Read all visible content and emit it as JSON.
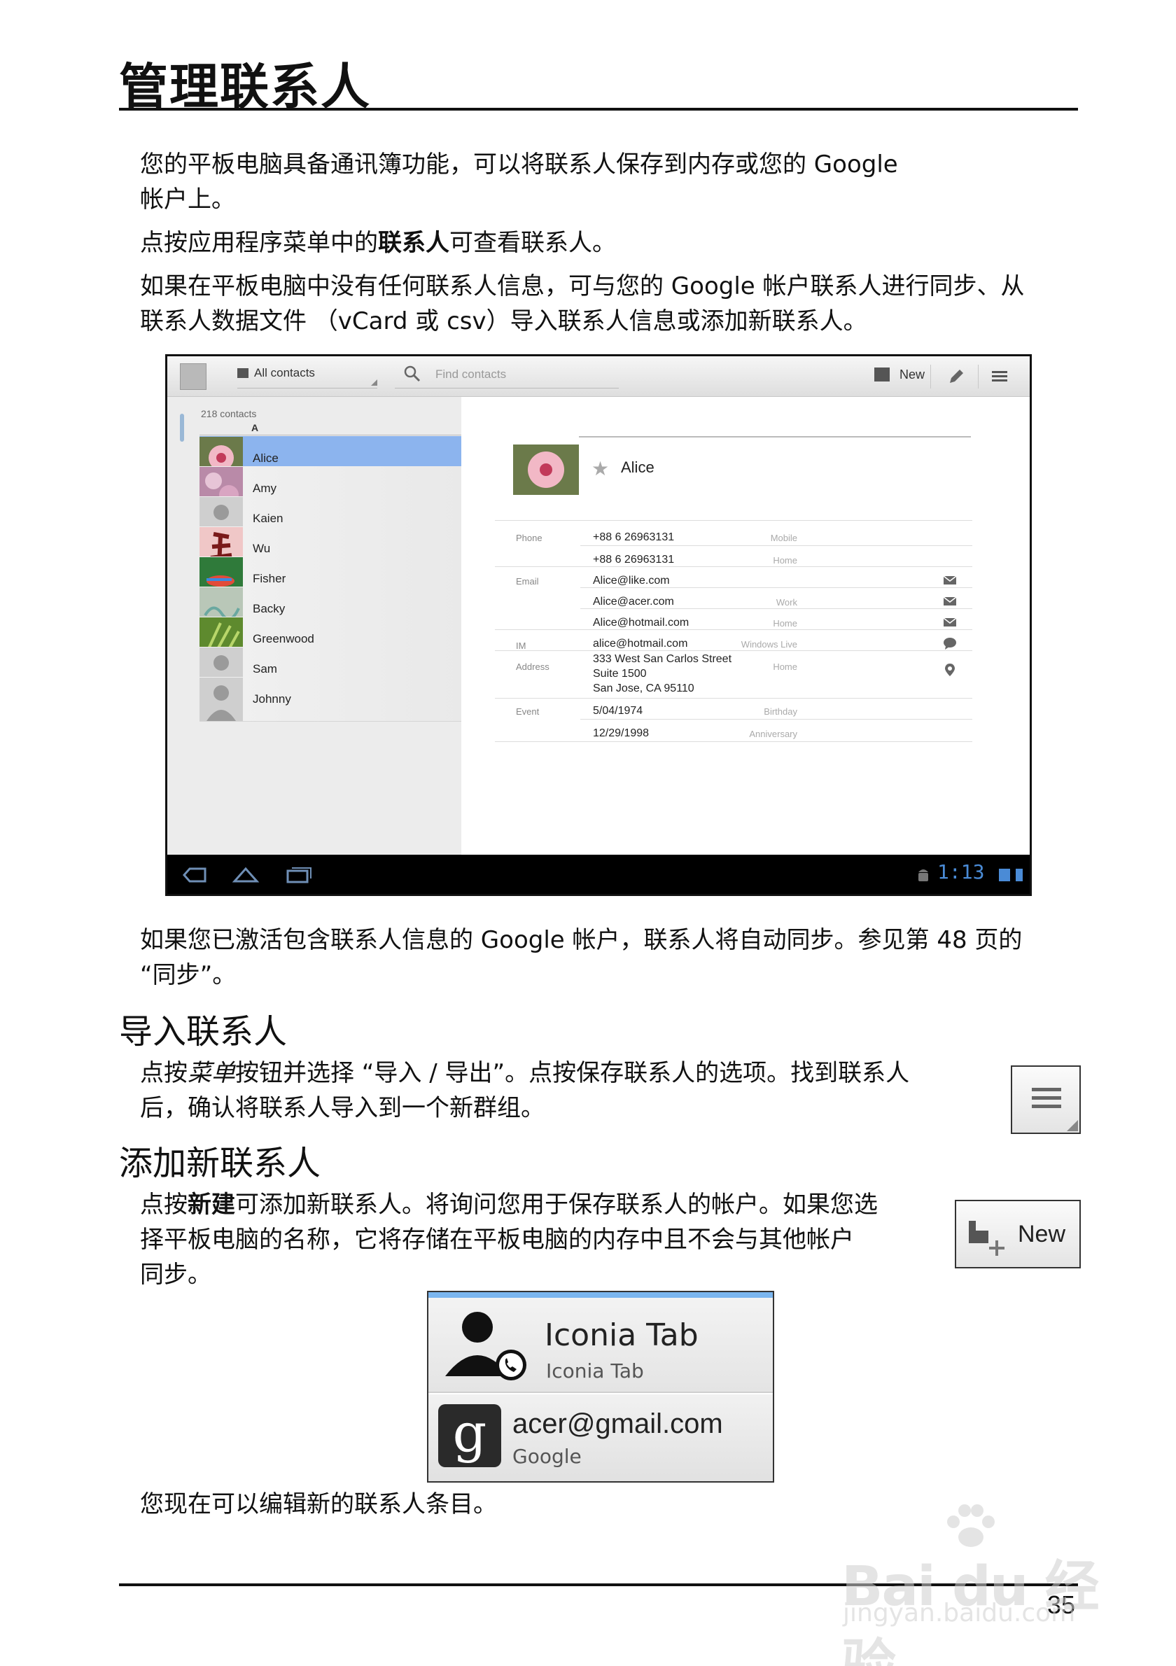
{
  "page": {
    "title": "管理联系人",
    "page_number": "35"
  },
  "intro": {
    "p1_line1": "您的平板电脑具备通讯簿功能，可以将联系人保存到内存或您的 Google",
    "p1_line2": "帐户上。",
    "p2_prefix": "点按应用程序菜单中的",
    "p2_bold": "联系人",
    "p2_suffix": "可查看联系人。",
    "p3_line1": "如果在平板电脑中没有任何联系人信息，可与您的 Google 帐户联系人进行同步、从",
    "p3_line2": "联系人数据文件 （vCard 或 csv）导入联系人信息或添加新联系人。"
  },
  "screenshot": {
    "toolbar": {
      "filter_label": "All contacts",
      "search_placeholder": "Find contacts",
      "new_label": "New"
    },
    "list": {
      "count": "218 contacts",
      "section_letter": "A",
      "contacts": [
        "Alice",
        "Amy",
        "Kaien",
        "Wu",
        "Fisher",
        "Backy",
        "Greenwood",
        "Sam",
        "Johnny"
      ],
      "selected": "Alice"
    },
    "detail": {
      "name": "Alice",
      "phone_label": "Phone",
      "phone1": "+88 6 26963131",
      "phone1_type": "Mobile",
      "phone2": "+88 6 26963131",
      "phone2_type": "Home",
      "email_label": "Email",
      "email1": "Alice@like.com",
      "email2": "Alice@acer.com",
      "email2_type": "Work",
      "email3": "Alice@hotmail.com",
      "email3_type": "Home",
      "im_label": "IM",
      "im": "alice@hotmail.com",
      "im_type": "Windows Live",
      "address_label": "Address",
      "address_line1": "333 West San Carlos Street",
      "address_line2": "Suite 1500",
      "address_line3": "San Jose, CA 95110",
      "address_type": "Home",
      "event_label": "Event",
      "event1": "5/04/1974",
      "event1_type": "Birthday",
      "event2": "12/29/1998",
      "event2_type": "Anniversary"
    },
    "status": {
      "time": "1:13"
    }
  },
  "sync_note": {
    "line1": "如果您已激活包含联系人信息的 Google 帐户，联系人将自动同步。参见第 48 页的",
    "line2": "“同步”。"
  },
  "import_section": {
    "heading": "导入联系人",
    "line1_a": "点按",
    "line1_italic": "菜单",
    "line1_b": "按钮并选择 “导入 / 导出”。点按保存联系人的选项。找到联系人",
    "line2": "后，确认将联系人导入到一个新群组。"
  },
  "add_section": {
    "heading": "添加新联系人",
    "line1_a": "点按",
    "line1_bold": "新建",
    "line1_b": "可添加新联系人。将询问您用于保存联系人的帐户。如果您选",
    "line2": "择平板电脑的名称，它将存储在平板电脑的内存中且不会与其他帐户",
    "line3": "同步。",
    "new_button_label": "New"
  },
  "account_picker": {
    "tablet_title": "Iconia Tab",
    "tablet_sub": "Iconia Tab",
    "google_title": "acer@gmail.com",
    "google_sub": "Google",
    "google_glyph": "g"
  },
  "closing": {
    "text": "您现在可以编辑新的联系人条目。"
  },
  "watermark": {
    "text": "Bai du 经验",
    "url": "jingyan.baidu.com"
  }
}
